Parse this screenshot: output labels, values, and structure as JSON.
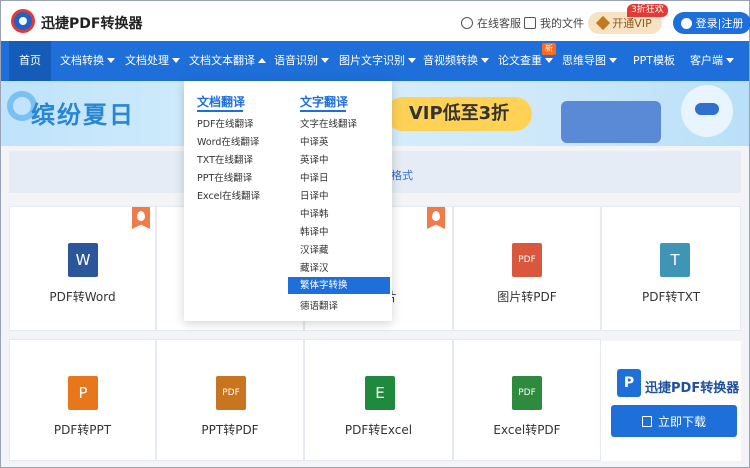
{
  "header": {
    "logo_text": "迅捷PDF转换器",
    "service_label": "在线客服",
    "my_files_label": "我的文件",
    "vip_label": "开通VIP",
    "vip_badge": "3折狂欢",
    "login_label": "登录|注册"
  },
  "nav": {
    "items": [
      {
        "label": "首页",
        "caret": "none"
      },
      {
        "label": "文档转换",
        "caret": "down"
      },
      {
        "label": "文档处理",
        "caret": "down"
      },
      {
        "label": "文档文本翻译",
        "caret": "up"
      },
      {
        "label": "语音识别",
        "caret": "down"
      },
      {
        "label": "图片文字识别",
        "caret": "down"
      },
      {
        "label": "音视频转换",
        "caret": "down"
      },
      {
        "label": "论文查重",
        "caret": "down"
      },
      {
        "label": "思维导图",
        "caret": "down"
      },
      {
        "label": "PPT模板",
        "caret": "none"
      },
      {
        "label": "客户端",
        "caret": "down"
      }
    ],
    "new_badge": "新"
  },
  "banner": {
    "title": "缤纷夏日",
    "vip_text": "VIP低至3折"
  },
  "subbar": {
    "text": "格式"
  },
  "dropdown": {
    "doc_translate": {
      "title": "文档翻译",
      "items": [
        "PDF在线翻译",
        "Word在线翻译",
        "TXT在线翻译",
        "PPT在线翻译",
        "Excel在线翻译"
      ]
    },
    "text_translate": {
      "title": "文字翻译",
      "items": [
        "文字在线翻译",
        "中译英",
        "英译中",
        "中译日",
        "日译中",
        "中译韩",
        "韩译中",
        "汉译藏",
        "藏译汉",
        "繁体字转换",
        "德语翻译"
      ],
      "active_index": 9
    }
  },
  "tools": [
    {
      "label": "PDF转Word",
      "icon": "W",
      "color": "#2b579a",
      "hot": true
    },
    {
      "label": "片",
      "icon": "",
      "color": "#ffffff",
      "hot": true
    },
    {
      "label": "图片转PDF",
      "icon": "PDF",
      "color": "#d9573d",
      "hot": false
    },
    {
      "label": "PDF转TXT",
      "icon": "T",
      "color": "#3e95b5",
      "hot": false
    },
    {
      "label": "PDF转PPT",
      "icon": "P",
      "color": "#e8761b",
      "hot": false
    },
    {
      "label": "PPT转PDF",
      "icon": "PDF",
      "color": "#c9741e",
      "hot": false
    },
    {
      "label": "PDF转Excel",
      "icon": "E",
      "color": "#1f8a3d",
      "hot": false
    },
    {
      "label": "Excel转PDF",
      "icon": "PDF",
      "color": "#2e8b3e",
      "hot": false
    }
  ],
  "download_panel": {
    "name": "迅捷PDF转换器",
    "button_label": "立即下载"
  }
}
